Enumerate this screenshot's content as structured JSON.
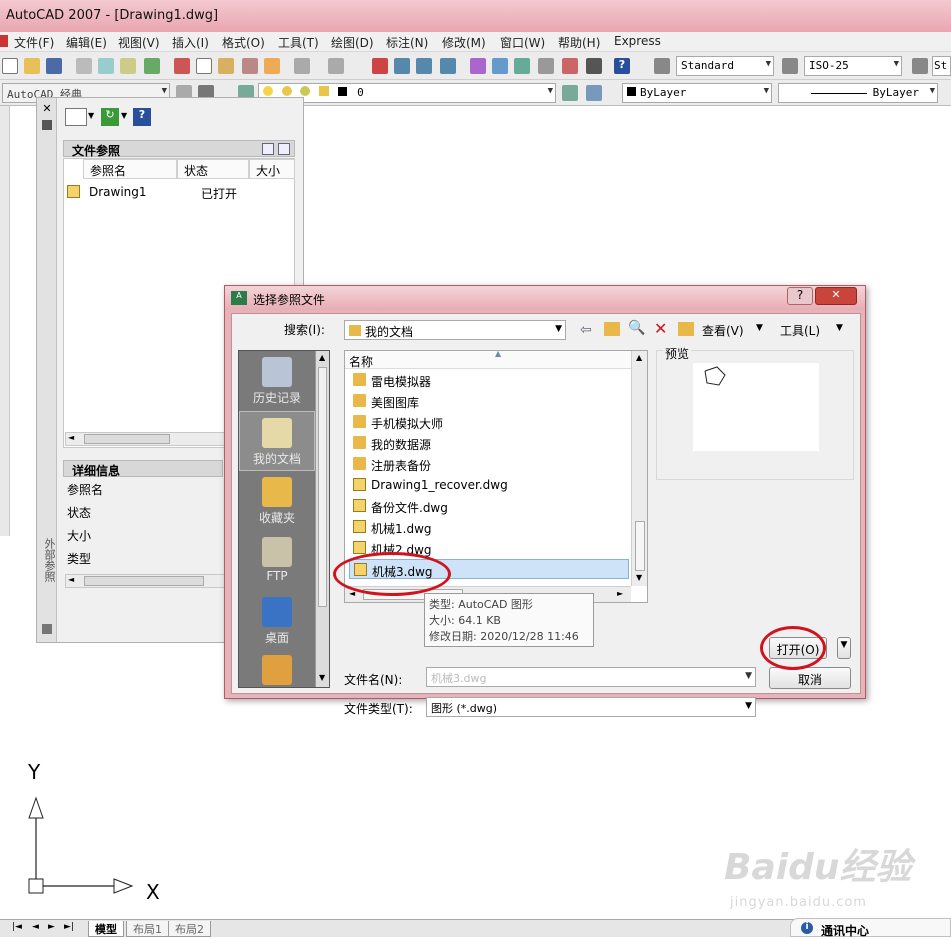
{
  "window": {
    "title": "AutoCAD 2007 - [Drawing1.dwg]"
  },
  "menu": [
    "文件(F)",
    "编辑(E)",
    "视图(V)",
    "插入(I)",
    "格式(O)",
    "工具(T)",
    "绘图(D)",
    "标注(N)",
    "修改(M)",
    "窗口(W)",
    "帮助(H)",
    "Express"
  ],
  "toolbar": {
    "text_style": "Standard",
    "dim_style": "ISO-25",
    "table_style_partial": "St",
    "workspace": "AutoCAD 经典",
    "layer": "0",
    "color": "ByLayer",
    "linetype": "ByLayer"
  },
  "xref_palette": {
    "side_label": "外部参照",
    "file_refs_header": "文件参照",
    "columns": {
      "name": "参照名",
      "status": "状态",
      "size": "大小"
    },
    "rows": [
      {
        "name": "Drawing1",
        "status": "已打开"
      }
    ],
    "details_header": "详细信息",
    "details_fields": [
      "参照名",
      "状态",
      "大小",
      "类型"
    ]
  },
  "dialog": {
    "title": "选择参照文件",
    "search_label": "搜索(I):",
    "look_in": "我的文档",
    "view_label": "查看(V)",
    "tools_label": "工具(L)",
    "name_column": "名称",
    "preview_label": "预览",
    "places": [
      "历史记录",
      "我的文档",
      "收藏夹",
      "FTP",
      "桌面"
    ],
    "files": [
      {
        "name": "雷电模拟器",
        "type": "folder"
      },
      {
        "name": "美图图库",
        "type": "folder"
      },
      {
        "name": "手机模拟大师",
        "type": "folder"
      },
      {
        "name": "我的数据源",
        "type": "folder"
      },
      {
        "name": "注册表备份",
        "type": "folder"
      },
      {
        "name": "Drawing1_recover.dwg",
        "type": "dwg"
      },
      {
        "name": "备份文件.dwg",
        "type": "dwg"
      },
      {
        "name": "机械1.dwg",
        "type": "dwg"
      },
      {
        "name": "机械2.dwg",
        "type": "dwg"
      },
      {
        "name": "机械3.dwg",
        "type": "dwg",
        "selected": true
      }
    ],
    "tooltip": {
      "type": "类型: AutoCAD 图形",
      "size": "大小: 64.1 KB",
      "modified": "修改日期: 2020/12/28 11:46"
    },
    "filename_label": "文件名(N):",
    "filename_value": "机械3.dwg",
    "filetype_label": "文件类型(T):",
    "filetype_value": "图形 (*.dwg)",
    "open_button": "打开(O)",
    "cancel_button": "取消",
    "help_glyph": "?",
    "close_glyph": "✕"
  },
  "ucs": {
    "y": "Y",
    "x": "X"
  },
  "layout_tabs": [
    "模型",
    "布局1",
    "布局2"
  ],
  "comm_center": "通讯中心",
  "watermark": {
    "main": "Baidu经验",
    "sub": "jingyan.baidu.com"
  },
  "colors": {
    "highlight": "#d0141e",
    "dialog_frame": "#e6b3b9",
    "selection": "#cfe3f8"
  }
}
